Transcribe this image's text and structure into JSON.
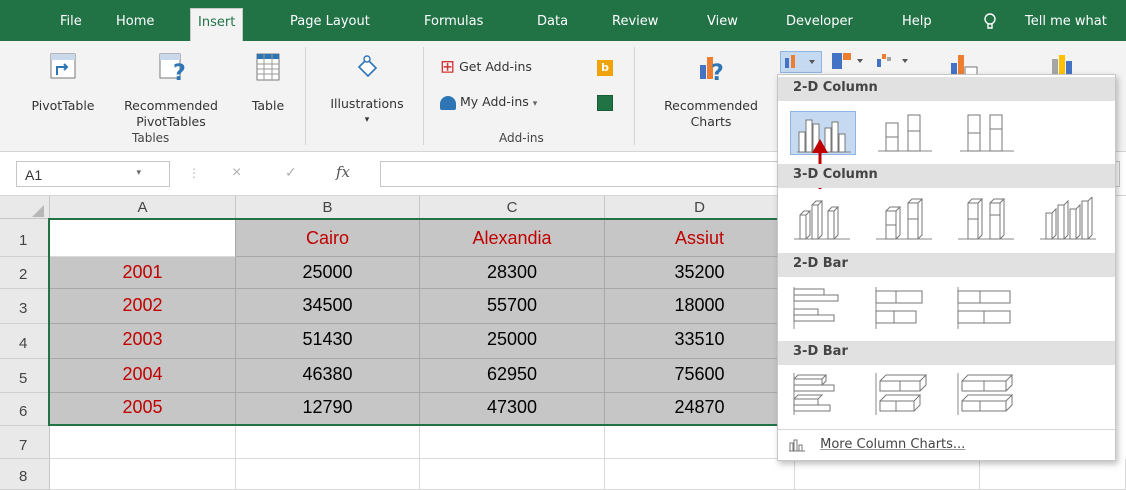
{
  "tabs": [
    "File",
    "Home",
    "Insert",
    "Page Layout",
    "Formulas",
    "Data",
    "Review",
    "View",
    "Developer",
    "Help",
    "Tell me what"
  ],
  "ribbon": {
    "pivottable": "PivotTable",
    "recommended_pivot": "Recommended",
    "recommended_pivot2": "PivotTables",
    "table": "Table",
    "tables_group": "Tables",
    "illustrations": "Illustrations",
    "get_addins": "Get Add-ins",
    "my_addins": "My Add-ins",
    "addins_group": "Add-ins",
    "rec_charts": "Recommended",
    "rec_charts2": "Charts"
  },
  "formula_bar": {
    "name_box": "A1",
    "fx": "fx"
  },
  "columns": [
    "A",
    "B",
    "C",
    "D"
  ],
  "rows": [
    "1",
    "2",
    "3",
    "4",
    "5",
    "6",
    "7",
    "8"
  ],
  "headers": [
    "",
    "Cairo",
    "Alexandia",
    "Assiut"
  ],
  "data": [
    [
      "2001",
      "25000",
      "28300",
      "35200"
    ],
    [
      "2002",
      "34500",
      "55700",
      "18000"
    ],
    [
      "2003",
      "51430",
      "25000",
      "33510"
    ],
    [
      "2004",
      "46380",
      "62950",
      "75600"
    ],
    [
      "2005",
      "12790",
      "47300",
      "24870"
    ]
  ],
  "dropdown": {
    "col2d": "2-D Column",
    "col3d": "3-D Column",
    "bar2d": "2-D Bar",
    "bar3d": "3-D Bar",
    "more": "More Column Charts..."
  }
}
